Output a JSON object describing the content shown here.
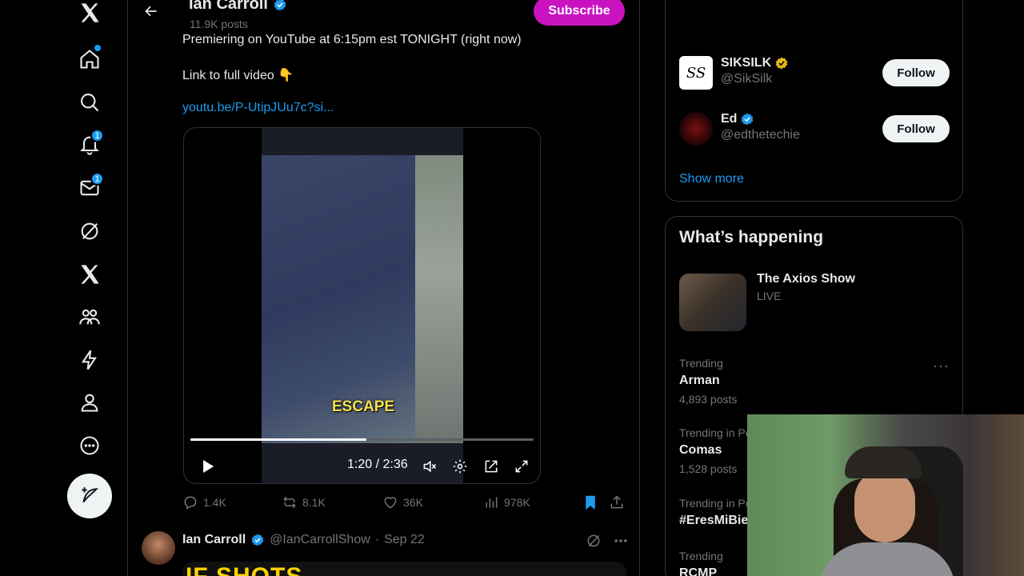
{
  "header": {
    "name": "Ian Carroll",
    "posts": "11.9K posts",
    "subscribe_label": "Subscribe"
  },
  "nav": {
    "notifications_badge": "1",
    "messages_badge": "1"
  },
  "tweet": {
    "line1": "Premiering on YouTube at 6:15pm est TONIGHT (right now)",
    "line2": "Link to full video 👇",
    "link": "youtu.be/P-UtipJUu7c?si...",
    "video": {
      "caption": "ESCAPE",
      "time": "1:20 / 2:36",
      "progress_fraction": 0.513
    },
    "actions": {
      "replies": "1.4K",
      "reposts": "8.1K",
      "likes": "36K",
      "views": "978K"
    }
  },
  "next_tweet": {
    "name": "Ian Carroll",
    "handle": "@IanCarrollShow",
    "sep": "·",
    "date": "Sep 22",
    "media_text": "IF SHOTS"
  },
  "search": {
    "placeholder": "Search"
  },
  "who_to_follow": {
    "accounts": [
      {
        "name": "SIKSILK",
        "handle": "@SikSilk",
        "follow": "Follow",
        "verified": "gold",
        "avatar_text": "SS"
      },
      {
        "name": "Ed",
        "handle": "@edthetechie",
        "follow": "Follow",
        "verified": "blue"
      }
    ],
    "show_more": "Show more"
  },
  "happening": {
    "title": "What’s happening",
    "live": {
      "title": "The Axios Show",
      "status": "LIVE"
    },
    "trends": [
      {
        "context": "Trending",
        "name": "Arman",
        "count": "4,893 posts"
      },
      {
        "context": "Trending in Pe",
        "name": "Comas",
        "count": "1,528 posts"
      },
      {
        "context": "Trending in Pe",
        "name": "#EresMiBie"
      },
      {
        "context": "Trending",
        "name": "RCMP"
      }
    ],
    "more_label": "···"
  },
  "colors": {
    "accent": "#1d9bf0",
    "subscribe": "#c913c0",
    "gold_badge": "#e2b719"
  }
}
